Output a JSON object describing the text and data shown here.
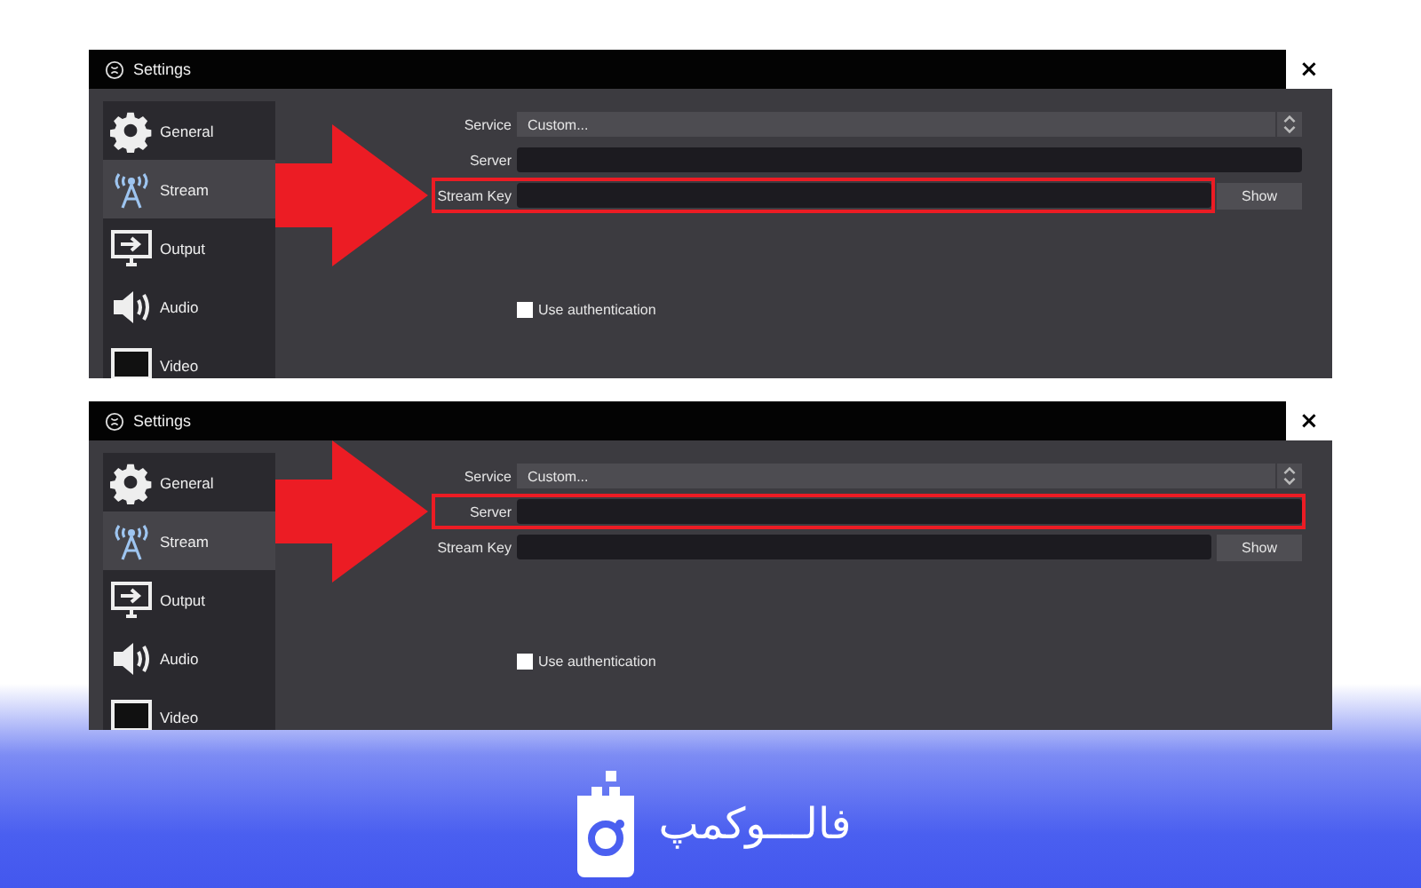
{
  "panels": [
    {
      "window": {
        "title": "Settings",
        "close": "×"
      },
      "sidebar": {
        "items": [
          {
            "kind": "gear",
            "label": "General",
            "selected": false
          },
          {
            "kind": "antenna",
            "label": "Stream",
            "selected": true
          },
          {
            "kind": "monitor",
            "label": "Output",
            "selected": false
          },
          {
            "kind": "speaker",
            "label": "Audio",
            "selected": false
          },
          {
            "kind": "screen",
            "label": "Video",
            "selected": false
          }
        ]
      },
      "form": {
        "rows": [
          {
            "kind": "select",
            "label": "Service",
            "value": "Custom...",
            "highlighted": false
          },
          {
            "kind": "text",
            "label": "Server",
            "highlighted": false
          },
          {
            "kind": "key",
            "label": "Stream Key",
            "button": "Show",
            "highlighted": true
          }
        ],
        "checkbox": {
          "label": "Use authentication",
          "checked": false
        }
      }
    },
    {
      "window": {
        "title": "Settings",
        "close": "×"
      },
      "sidebar": {
        "items": [
          {
            "kind": "gear",
            "label": "General",
            "selected": false
          },
          {
            "kind": "antenna",
            "label": "Stream",
            "selected": true
          },
          {
            "kind": "monitor",
            "label": "Output",
            "selected": false
          },
          {
            "kind": "speaker",
            "label": "Audio",
            "selected": false
          },
          {
            "kind": "screen",
            "label": "Video",
            "selected": false
          }
        ]
      },
      "form": {
        "rows": [
          {
            "kind": "select",
            "label": "Service",
            "value": "Custom...",
            "highlighted": false
          },
          {
            "kind": "text",
            "label": "Server",
            "highlighted": true
          },
          {
            "kind": "key",
            "label": "Stream Key",
            "button": "Show",
            "highlighted": false
          }
        ],
        "checkbox": {
          "label": "Use authentication",
          "checked": false
        }
      }
    }
  ],
  "brand": {
    "name": "فالـــوکمپ"
  }
}
